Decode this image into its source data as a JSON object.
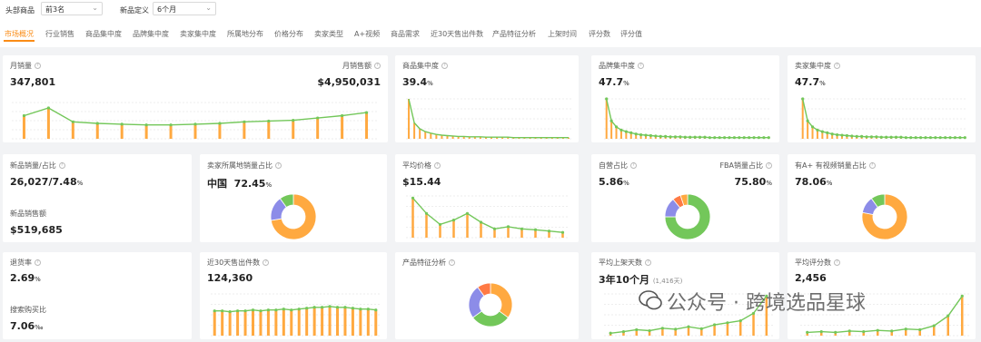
{
  "filters": {
    "top_label": "头部商品",
    "top_value": "前3名",
    "new_label": "新品定义",
    "new_value": "6个月"
  },
  "tabs": [
    "市场概况",
    "行业销售",
    "商品集中度",
    "品牌集中度",
    "卖家集中度",
    "所属地分布",
    "价格分布",
    "卖家类型",
    "A+视频",
    "商品需求",
    "近30天售出件数",
    "产品特征分析",
    "上架时间",
    "评分数",
    "评分值"
  ],
  "cards": {
    "monthly_sales": {
      "title": "月销量",
      "value": "347,801"
    },
    "monthly_revenue": {
      "title": "月销售额",
      "value": "$4,950,031"
    },
    "product_conc": {
      "title": "商品集中度",
      "value": "39.4",
      "unit": "%"
    },
    "brand_conc": {
      "title": "品牌集中度",
      "value": "47.7",
      "unit": "%"
    },
    "seller_conc": {
      "title": "卖家集中度",
      "value": "47.7",
      "unit": "%"
    },
    "new_sales": {
      "title": "新品销量/占比",
      "value": "26,027/7.48",
      "unit": "%"
    },
    "new_revenue": {
      "title": "新品销售额",
      "value": "$519,685"
    },
    "seller_origin": {
      "title": "卖家所属地销量占比",
      "region": "中国",
      "value": "72.45",
      "unit": "%"
    },
    "avg_price": {
      "title": "平均价格",
      "value": "$15.44"
    },
    "self_operated": {
      "title": "自营占比",
      "value": "5.86",
      "unit": "%"
    },
    "fba": {
      "title": "FBA销量占比",
      "value": "75.80",
      "unit": "%"
    },
    "aplus": {
      "title": "有A+ 有视频销量占比",
      "value": "78.06",
      "unit": "%"
    },
    "return_rate": {
      "title": "退货率",
      "value": "2.69",
      "unit": "%"
    },
    "search_rate": {
      "title": "搜索购买比",
      "value": "7.06",
      "unit": "‰"
    },
    "sold30": {
      "title": "近30天售出件数",
      "value": "124,360"
    },
    "features": {
      "title": "产品特征分析"
    },
    "listing": {
      "title": "平均上架天数",
      "value": "3年10个月",
      "sub": "(1,416天)"
    },
    "rating_count": {
      "title": "平均评分数",
      "value": "2,456"
    }
  },
  "watermark": "公众号 · 跨境选品星球",
  "colors": {
    "accent": "#fa8c16",
    "bar": "#ffa940",
    "line": "#73c75a",
    "purple": "#8c8ce8",
    "orange_slice": "#ff7a45"
  },
  "chart_data": [
    {
      "type": "line",
      "name": "monthly_sales_trend",
      "values": [
        30,
        40,
        22,
        20,
        19,
        18,
        18,
        19,
        20,
        22,
        23,
        24,
        27,
        30,
        34
      ]
    },
    {
      "type": "line",
      "name": "product_concentration",
      "values": [
        100,
        40,
        25,
        18,
        14,
        11,
        9,
        8,
        7,
        6,
        6,
        5,
        5,
        5,
        4,
        4,
        4,
        4,
        4,
        3,
        3,
        3,
        3,
        3,
        3,
        3,
        3,
        3,
        3,
        3
      ]
    },
    {
      "type": "line",
      "name": "brand_concentration",
      "values": [
        100,
        45,
        30,
        22,
        18,
        15,
        12,
        10,
        9,
        8,
        7,
        6,
        6,
        5,
        5,
        5,
        4,
        4,
        4,
        4,
        4,
        3,
        3,
        3,
        3,
        3,
        3,
        3,
        3,
        3,
        3,
        3,
        3,
        3
      ]
    },
    {
      "type": "line",
      "name": "seller_concentration",
      "values": [
        100,
        45,
        30,
        22,
        18,
        15,
        12,
        10,
        9,
        8,
        7,
        6,
        6,
        5,
        5,
        5,
        4,
        4,
        4,
        4,
        4,
        3,
        3,
        3,
        3,
        3,
        3,
        3,
        3,
        3,
        3,
        3,
        3,
        3
      ]
    },
    {
      "type": "pie",
      "name": "seller_origin",
      "values": [
        72.45,
        17.55,
        10
      ]
    },
    {
      "type": "line",
      "name": "avg_price_distribution",
      "values": [
        90,
        55,
        30,
        40,
        55,
        35,
        20,
        25,
        20,
        18,
        15,
        12
      ]
    },
    {
      "type": "pie",
      "name": "self_operated",
      "values": [
        75,
        14,
        5.86,
        5.14
      ]
    },
    {
      "type": "pie",
      "name": "aplus_video",
      "values": [
        78.06,
        12,
        9.94
      ]
    },
    {
      "type": "bar",
      "name": "sold30_trend",
      "values": [
        28,
        28,
        27,
        28,
        28,
        29,
        28,
        29,
        29,
        30,
        29,
        30,
        31,
        32,
        32,
        33,
        32,
        32,
        31,
        30,
        30,
        29
      ]
    },
    {
      "type": "pie",
      "name": "product_features",
      "values": [
        35,
        30,
        25,
        10
      ]
    },
    {
      "type": "line",
      "name": "listing_days",
      "values": [
        5,
        8,
        12,
        10,
        15,
        13,
        18,
        14,
        22,
        26,
        30,
        45,
        80
      ]
    },
    {
      "type": "line",
      "name": "rating_count",
      "values": [
        5,
        6,
        5,
        7,
        6,
        8,
        7,
        10,
        9,
        15,
        30,
        60
      ]
    }
  ]
}
